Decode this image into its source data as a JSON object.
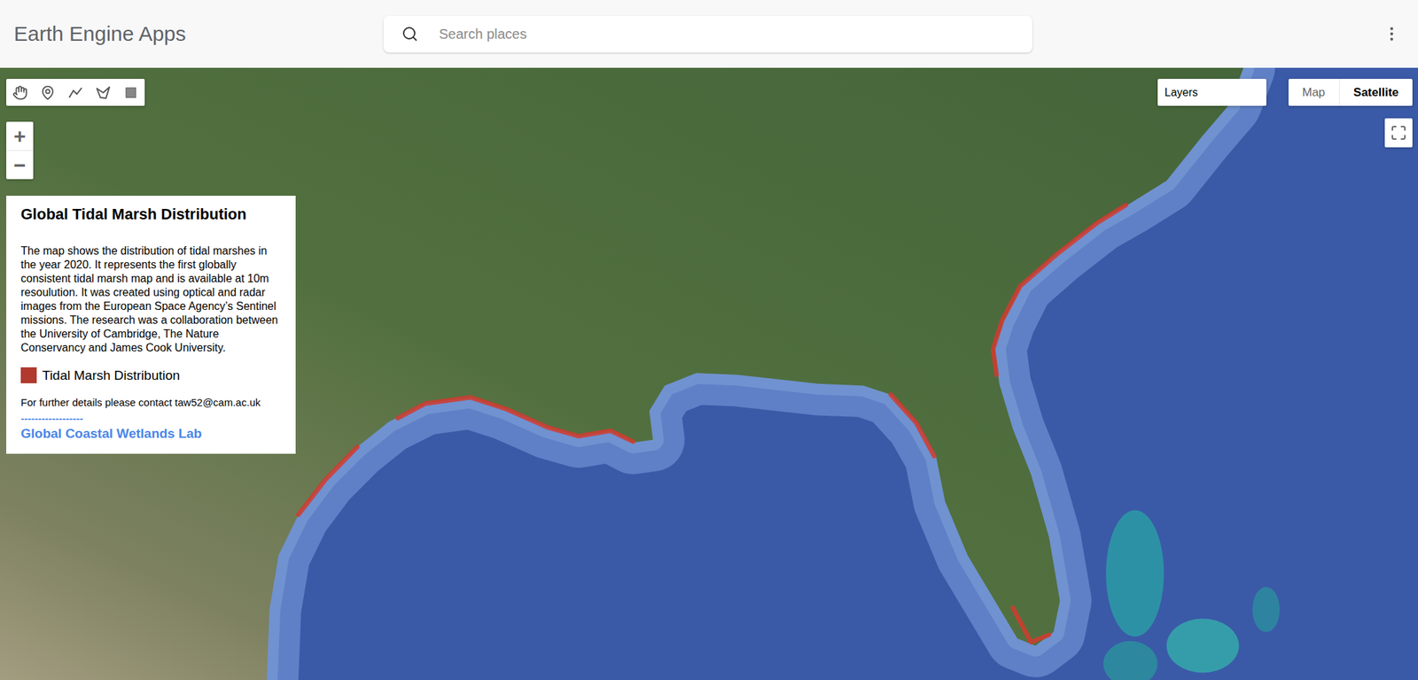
{
  "header": {
    "title": "Earth Engine Apps",
    "search": {
      "placeholder": "Search places"
    }
  },
  "zoom": {
    "in": "+",
    "out": "−"
  },
  "layers": {
    "label": "Layers"
  },
  "map_types": [
    {
      "label": "Map",
      "selected": false
    },
    {
      "label": "Satellite",
      "selected": true
    }
  ],
  "panel": {
    "title": "Global Tidal Marsh Distribution",
    "description": "The map shows the distribution of tidal marshes in the year 2020. It represents the first globally consistent tidal marsh map and is available at 10m resoulution. It was created using optical and radar images from the European Space Agency’s Sentinel missions. The research was a collaboration between the University of Cambridge, The Nature Conservancy and James Cook University.",
    "legend": [
      {
        "label": "Tidal Marsh Distribution",
        "color": "#b03a2e"
      }
    ],
    "contact": "For further details please contact taw52@cam.ac.uk",
    "divider": "------------------",
    "link": "Global Coastal Wetlands Lab"
  }
}
